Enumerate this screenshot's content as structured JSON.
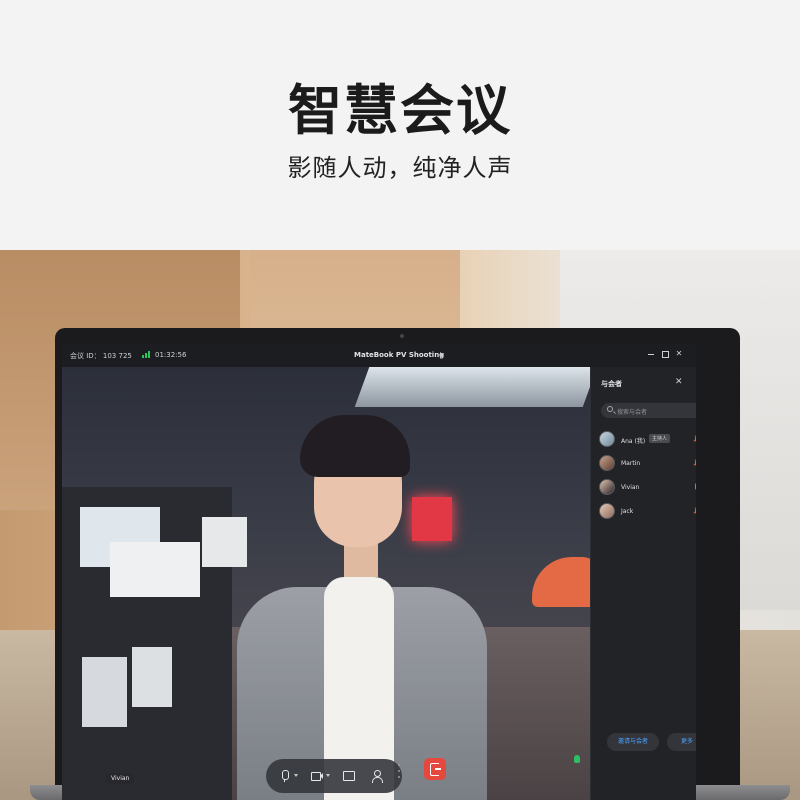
{
  "hero": {
    "title": "智慧会议",
    "subtitle": "影随人动，纯净人声"
  },
  "titlebar": {
    "meeting_id": "会议 ID： 103 725",
    "signal_icon": "signal-bars-icon",
    "timer": "01:32:56",
    "window_title": "MateBook PV Shooting",
    "window_controls": [
      "minimize-icon",
      "maximize-icon",
      "close-icon"
    ]
  },
  "video": {
    "speaker_name": "Vivian"
  },
  "controls": {
    "icons": [
      "microphone-icon",
      "camera-icon",
      "share-screen-icon",
      "participants-icon",
      "more-icon",
      "leave-icon"
    ]
  },
  "side_panel": {
    "title": "与会者",
    "close": "✕",
    "search_placeholder": "搜索与会者",
    "participants": [
      {
        "name": "Ana (我)",
        "badge": "主持人",
        "mic": "muted"
      },
      {
        "name": "Martin",
        "badge": "",
        "mic": "muted"
      },
      {
        "name": "Vivian",
        "badge": "",
        "mic": "active"
      },
      {
        "name": "Jack",
        "badge": "",
        "mic": "muted"
      }
    ],
    "invite_label": "邀请与会者",
    "more_label": "更多"
  },
  "colors": {
    "accent_blue": "#4aa3ff",
    "leave_red": "#e5483d",
    "mic_active_green": "#2fbf63"
  }
}
